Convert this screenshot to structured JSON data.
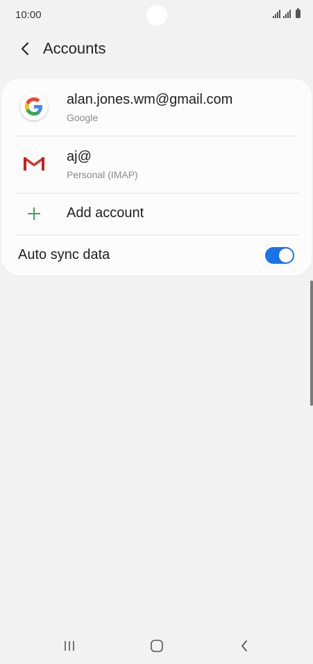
{
  "status_bar": {
    "time": "10:00"
  },
  "header": {
    "title": "Accounts"
  },
  "accounts": [
    {
      "title": "alan.jones.wm@gmail.com",
      "subtitle": "Google",
      "icon": "google-icon"
    },
    {
      "title": "aj@",
      "subtitle": "Personal (IMAP)",
      "icon": "gmail-icon"
    }
  ],
  "add_account": {
    "label": "Add account",
    "icon": "plus-icon"
  },
  "auto_sync": {
    "label": "Auto sync data",
    "enabled": true
  },
  "colors": {
    "accent": "#1a73e8",
    "plus": "#3aa757",
    "background": "#f2f2f2",
    "card": "#fcfcfc"
  },
  "nav": {
    "recent_icon": "recent-apps-icon",
    "home_icon": "home-icon",
    "back_icon": "back-icon"
  }
}
